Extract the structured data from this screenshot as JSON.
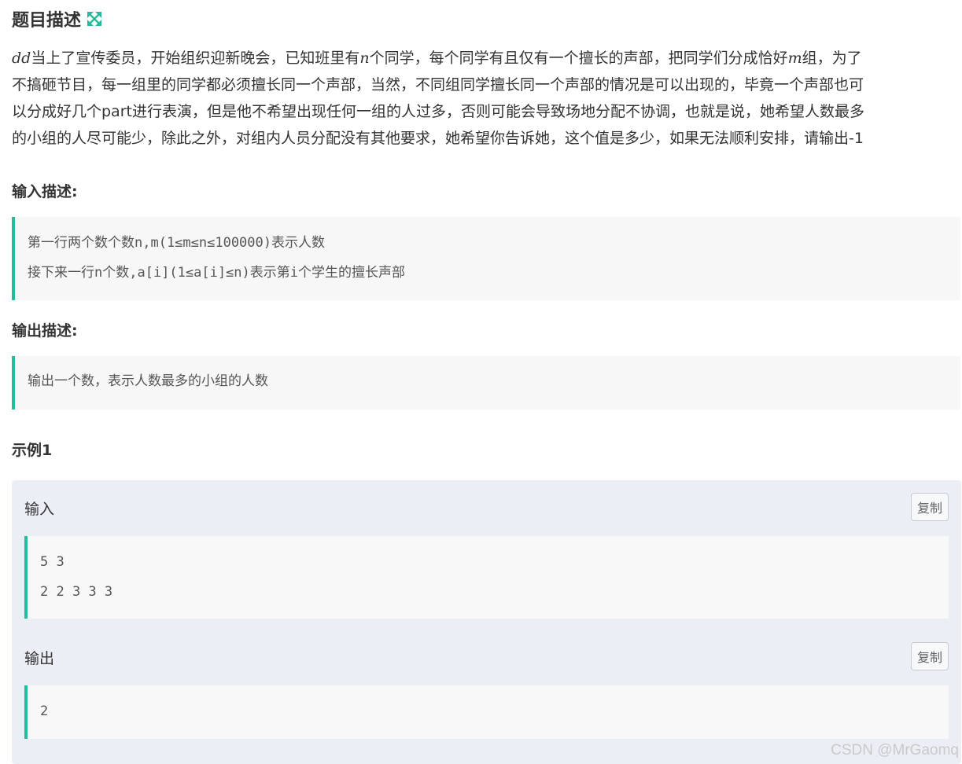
{
  "problem": {
    "title": "题目描述",
    "expand_icon": "expand-arrows-icon",
    "accent_color": "#25bb9b",
    "description_lines": [
      [
        {
          "t": "dd",
          "var": true
        },
        {
          "t": "当上了宣传委员，开始组织迎新晚会，已知班里有"
        },
        {
          "t": "n",
          "var": true
        },
        {
          "t": "个同学，每个同学有且仅有一个擅长的声部，把同学们分成恰好"
        },
        {
          "t": "m",
          "var": true
        },
        {
          "t": "组，为了"
        }
      ],
      [
        {
          "t": "不搞砸节目，每一组里的同学都必须擅长同一个声部，当然，不同组同学擅长同一个声部的情况是可以出现的，毕竟一个声部也可"
        }
      ],
      [
        {
          "t": "以分成好几个part进行表演，但是他不希望出现任何一组的人过多，否则可能会导致场地分配不协调，也就是说，她希望人数最多"
        }
      ],
      [
        {
          "t": "的小组的人尽可能少，除此之外，对组内人员分配没有其他要求，她希望你告诉她，这个值是多少，如果无法顺利安排，请输出-1"
        }
      ]
    ]
  },
  "input_section": {
    "label": "输入描述:",
    "lines": [
      "第一行两个数个数n,m(1≤m≤n≤100000)表示人数",
      "接下来一行n个数,a[i](1≤a[i]≤n)表示第i个学生的擅长声部"
    ]
  },
  "output_section": {
    "label": "输出描述:",
    "lines": [
      "输出一个数，表示人数最多的小组的人数"
    ]
  },
  "example": {
    "title": "示例1",
    "input_label": "输入",
    "input_lines": [
      "5 3",
      "2 2 3 3 3"
    ],
    "output_label": "输出",
    "output_lines": [
      "2"
    ],
    "copy_label": "复制"
  },
  "watermark": "CSDN @MrGaomq"
}
